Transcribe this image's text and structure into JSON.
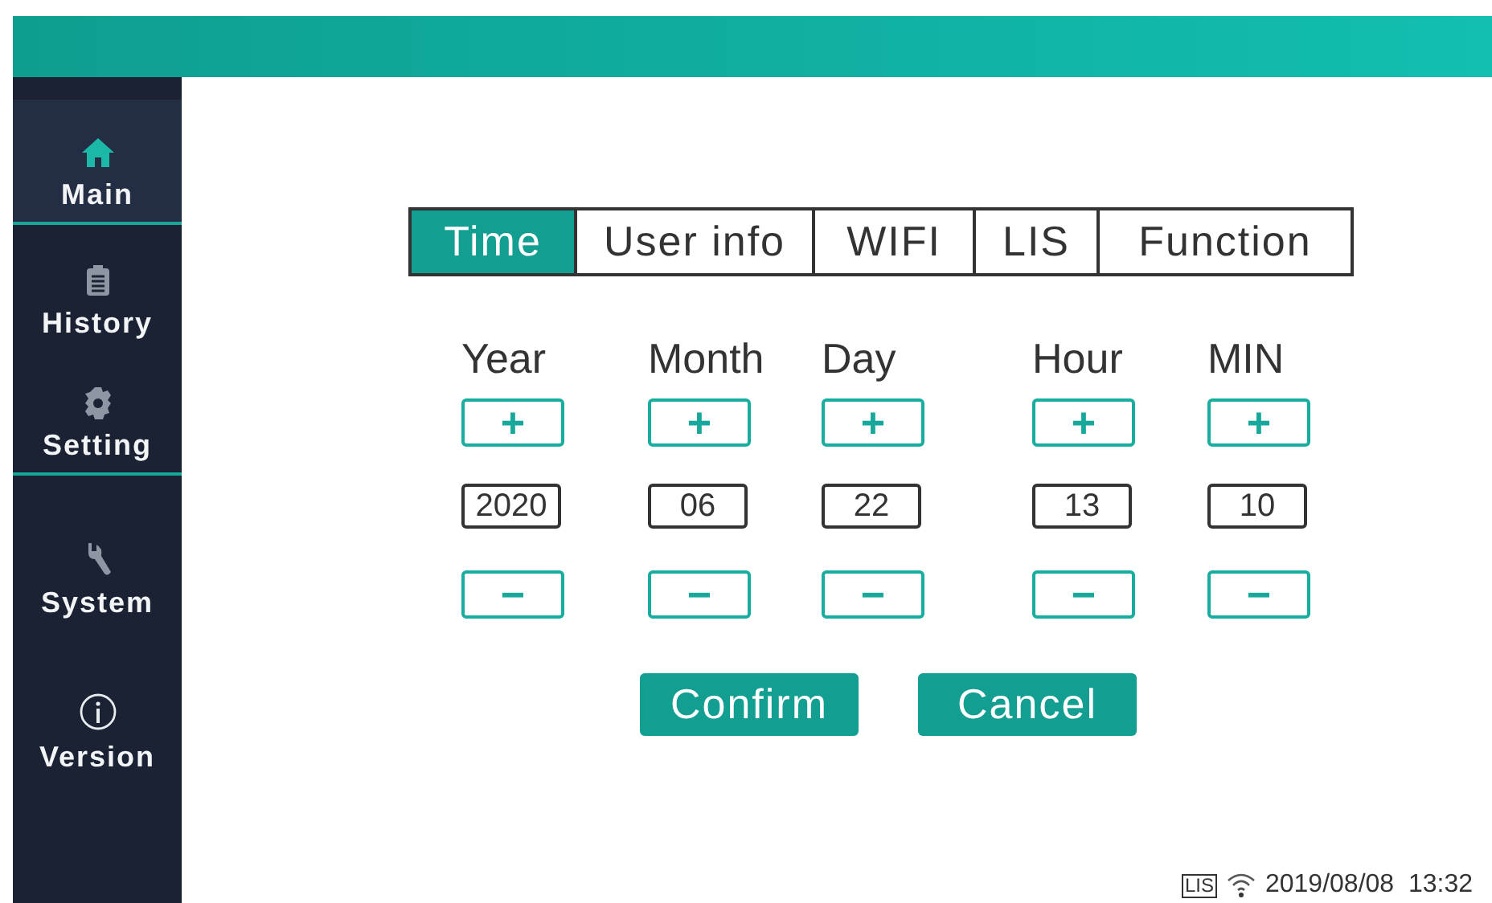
{
  "sidebar": {
    "items": [
      {
        "kind": "home",
        "label": "Main",
        "selected": true
      },
      {
        "kind": "clipboard",
        "label": "History",
        "selected": false
      },
      {
        "kind": "gear",
        "label": "Setting",
        "selected": false
      },
      {
        "kind": "wrench",
        "label": "System",
        "selected": false
      },
      {
        "kind": "info",
        "label": "Version",
        "selected": false
      }
    ]
  },
  "tabs": [
    {
      "label": "Time",
      "selected": true
    },
    {
      "label": "User info",
      "selected": false
    },
    {
      "label": "WIFI",
      "selected": false
    },
    {
      "label": "LIS",
      "selected": false
    },
    {
      "label": "Function",
      "selected": false
    }
  ],
  "fields": [
    {
      "label": "Year",
      "plus": "+",
      "value": "2020",
      "minus": "−"
    },
    {
      "label": "Month",
      "plus": "+",
      "value": "06",
      "minus": "−"
    },
    {
      "label": "Day",
      "plus": "+",
      "value": "22",
      "minus": "−"
    },
    {
      "label": "Hour",
      "plus": "+",
      "value": "13",
      "minus": "−"
    },
    {
      "label": "MIN",
      "plus": "+",
      "value": "10",
      "minus": "−"
    }
  ],
  "buttons": [
    "Confirm",
    "Cancel"
  ],
  "status_bar": {
    "lis": "LIS",
    "datetime": "2019/08/08  13:32"
  }
}
